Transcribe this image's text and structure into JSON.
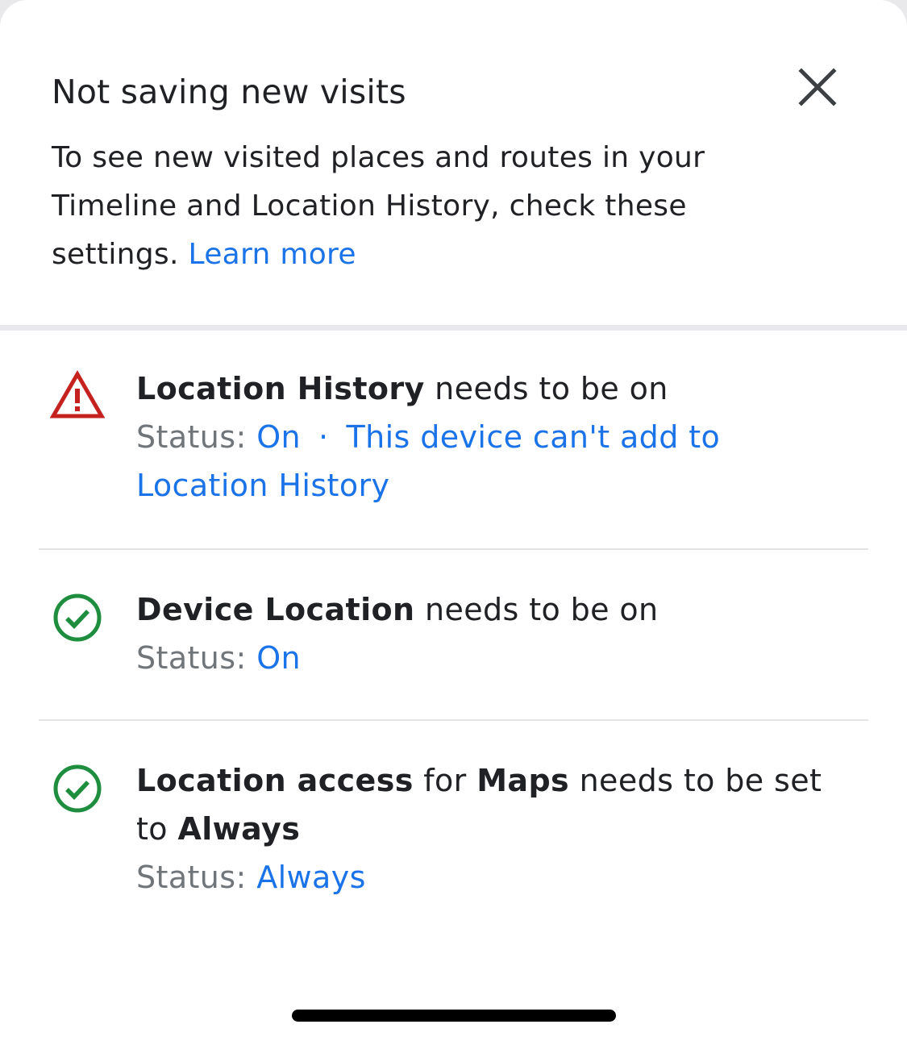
{
  "header": {
    "title": "Not saving new visits",
    "description": "To see new visited places and routes in your Timeline and Location History, check these settings.",
    "learn_more": "Learn more"
  },
  "items": [
    {
      "icon": "warning-triangle-icon",
      "icon_color": "#c5221f",
      "title_bold": "Location History",
      "title_rest": " needs to be on",
      "status_label": "Status:",
      "status_value": "On",
      "status_separator": "·",
      "status_extra": "This device can't add to Location History"
    },
    {
      "icon": "check-circle-icon",
      "icon_color": "#1e8e3e",
      "title_bold": "Device Location",
      "title_rest": " needs to be on",
      "status_label": "Status:",
      "status_value": "On"
    },
    {
      "icon": "check-circle-icon",
      "icon_color": "#1e8e3e",
      "title_bold_1": "Location access",
      "title_mid": " for ",
      "title_bold_2": "Maps",
      "title_rest": " needs to be set to ",
      "title_bold_3": "Always",
      "status_label": "Status:",
      "status_value": "Always"
    }
  ],
  "colors": {
    "link": "#1a73e8",
    "text": "#202124",
    "secondary": "#70757a"
  }
}
